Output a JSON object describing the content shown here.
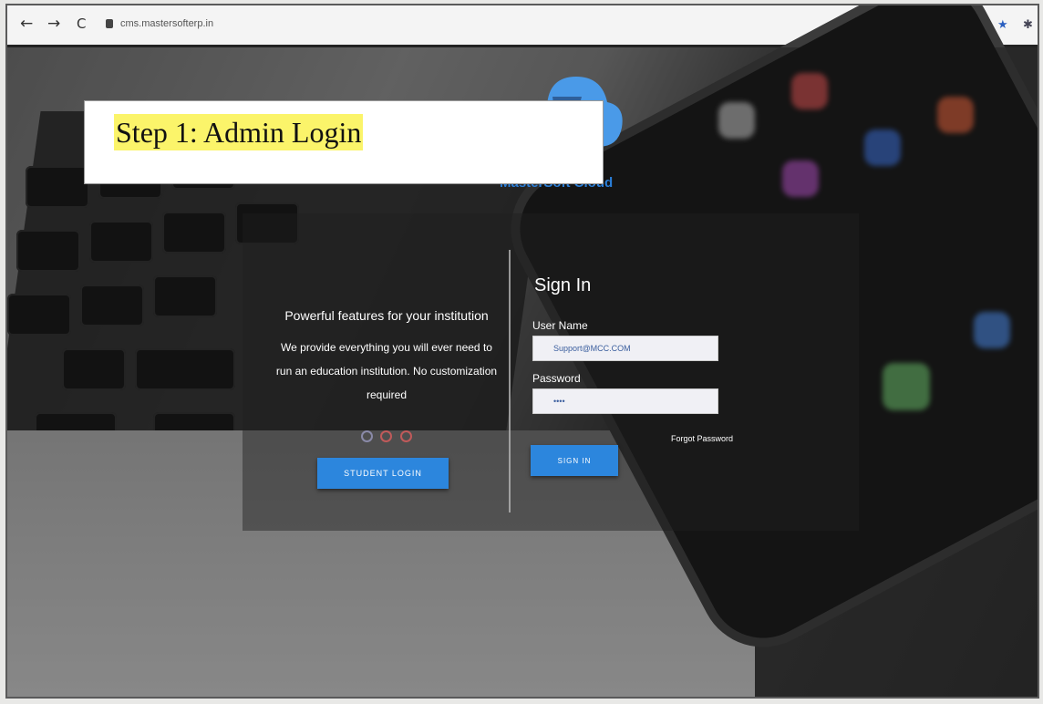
{
  "browser": {
    "url": "cms.mastersofterp.in",
    "back_glyph": "←",
    "forward_glyph": "→",
    "reload_glyph": "C",
    "icons": [
      "key-icon",
      "zoom-icon",
      "star-icon",
      "extension-icon"
    ]
  },
  "banner": {
    "text": "Step 1: Admin Login",
    "highlight_color": "#fbf46a"
  },
  "logo": {
    "text": "MasterSoft Cloud",
    "color": "#2a7ed8"
  },
  "promo": {
    "title": "Powerful features for your institution",
    "subtitle": "We provide everything you will ever need to run an education institution. No customization required",
    "student_button": "STUDENT LOGIN"
  },
  "signin": {
    "title": "Sign In",
    "username_label": "User Name",
    "username_value": "Support@MCC.COM",
    "password_label": "Password",
    "password_value": "••••",
    "forgot_link": "Forgot Password",
    "submit_button": "SIGN IN",
    "accent_color": "#2c86dd"
  }
}
